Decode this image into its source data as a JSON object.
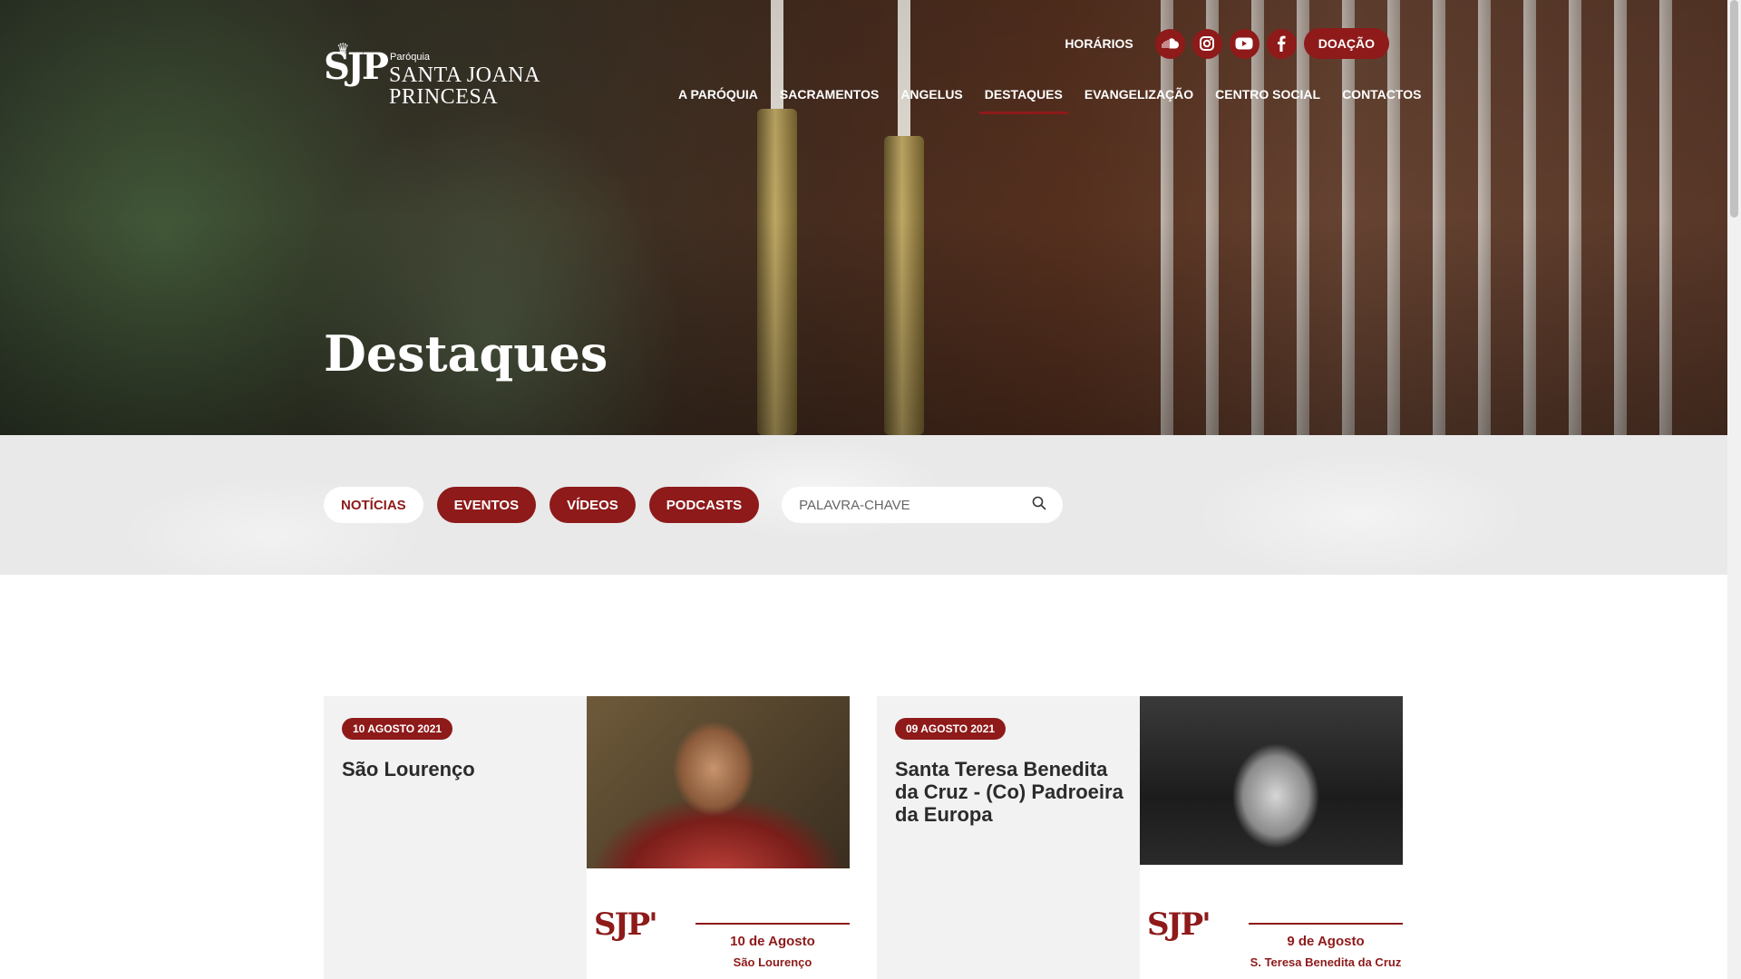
{
  "brand": {
    "mark": "SJP",
    "small": "Paróquia",
    "line1": "SANTA JOANA",
    "line2": "PRINCESA"
  },
  "topbar": {
    "schedule_label": "HORÁRIOS",
    "social": [
      "soundcloud-icon",
      "instagram-icon",
      "youtube-icon",
      "facebook-icon"
    ],
    "donate_label": "DOAÇÃO"
  },
  "nav": {
    "items": [
      {
        "label": "A PARÓQUIA"
      },
      {
        "label": "SACRAMENTOS"
      },
      {
        "label": "ANGELUS"
      },
      {
        "label": "DESTAQUES"
      },
      {
        "label": "EVANGELIZAÇÃO"
      },
      {
        "label": "CENTRO SOCIAL"
      },
      {
        "label": "CONTACTOS"
      }
    ],
    "active": "DESTAQUES"
  },
  "hero": {
    "title": "Destaques"
  },
  "filters": {
    "pills": [
      {
        "label": "NOTÍCIAS"
      },
      {
        "label": "EVENTOS"
      },
      {
        "label": "VÍDEOS"
      },
      {
        "label": "PODCASTS"
      }
    ],
    "search_placeholder": "PALAVRA-CHAVE"
  },
  "cards": [
    {
      "date": "10 AGOSTO 2021",
      "title": "São Lourenço",
      "thumb_mark": "SJP'",
      "thumb_date": "10 de Agosto",
      "thumb_name": "São Lourenço"
    },
    {
      "date": "09 AGOSTO 2021",
      "title": "Santa Teresa Benedita da Cruz - (Co) Padroeira da Europa",
      "thumb_mark": "SJP'",
      "thumb_date": "9 de Agosto",
      "thumb_name": "S. Teresa Benedita da Cruz"
    }
  ],
  "colors": {
    "accent": "#8e1a1a",
    "filter_bg": "#e9e9e9",
    "card_bg": "#f2f2f2"
  }
}
